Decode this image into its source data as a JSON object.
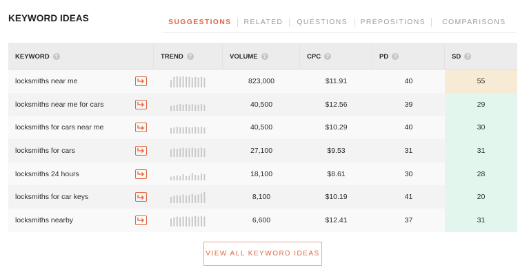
{
  "title": "KEYWORD IDEAS",
  "tabs": [
    "SUGGESTIONS",
    "RELATED",
    "QUESTIONS",
    "PREPOSITIONS",
    "COMPARISONS"
  ],
  "active_tab": "SUGGESTIONS",
  "columns": {
    "keyword": "KEYWORD",
    "trend": "TREND",
    "volume": "VOLUME",
    "cpc": "CPC",
    "pd": "PD",
    "sd": "SD"
  },
  "help_icon": "question-icon",
  "row_icon": "arrow-export-icon",
  "rows": [
    {
      "keyword": "locksmiths near me",
      "volume": "823,000",
      "cpc": "$11.91",
      "pd": "40",
      "sd": "55",
      "sd_color": "#f8ebd6",
      "trend": [
        0.6,
        0.85,
        0.9,
        0.85,
        0.9,
        0.85,
        0.85,
        0.8,
        0.85,
        0.8,
        0.85,
        0.8
      ]
    },
    {
      "keyword": "locksmiths near me for cars",
      "volume": "40,500",
      "cpc": "$12.56",
      "pd": "39",
      "sd": "29",
      "sd_color": "#e2f6ed",
      "trend": [
        0.4,
        0.45,
        0.5,
        0.55,
        0.5,
        0.55,
        0.5,
        0.55,
        0.5,
        0.5,
        0.55,
        0.5
      ]
    },
    {
      "keyword": "locksmiths for cars near me",
      "volume": "40,500",
      "cpc": "$10.29",
      "pd": "40",
      "sd": "30",
      "sd_color": "#e2f6ed",
      "trend": [
        0.45,
        0.5,
        0.55,
        0.5,
        0.5,
        0.55,
        0.5,
        0.5,
        0.55,
        0.5,
        0.55,
        0.5
      ]
    },
    {
      "keyword": "locksmiths for cars",
      "volume": "27,100",
      "cpc": "$9.53",
      "pd": "31",
      "sd": "31",
      "sd_color": "#e2f6ed",
      "trend": [
        0.6,
        0.7,
        0.65,
        0.7,
        0.75,
        0.7,
        0.7,
        0.75,
        0.7,
        0.7,
        0.75,
        0.7
      ]
    },
    {
      "keyword": "locksmiths 24 hours",
      "volume": "18,100",
      "cpc": "$8.61",
      "pd": "30",
      "sd": "28",
      "sd_color": "#e2f6ed",
      "trend": [
        0.3,
        0.35,
        0.4,
        0.35,
        0.5,
        0.35,
        0.4,
        0.6,
        0.45,
        0.4,
        0.55,
        0.5
      ]
    },
    {
      "keyword": "locksmiths for car keys",
      "volume": "8,100",
      "cpc": "$10.19",
      "pd": "41",
      "sd": "20",
      "sd_color": "#e2f6ed",
      "trend": [
        0.5,
        0.6,
        0.65,
        0.6,
        0.7,
        0.6,
        0.65,
        0.75,
        0.65,
        0.7,
        0.8,
        0.9
      ]
    },
    {
      "keyword": "locksmiths nearby",
      "volume": "6,600",
      "cpc": "$12.41",
      "pd": "37",
      "sd": "31",
      "sd_color": "#e2f6ed",
      "trend": [
        0.65,
        0.75,
        0.8,
        0.75,
        0.8,
        0.8,
        0.75,
        0.8,
        0.85,
        0.8,
        0.85,
        0.8
      ]
    }
  ],
  "view_all_label": "VIEW ALL KEYWORD IDEAS"
}
